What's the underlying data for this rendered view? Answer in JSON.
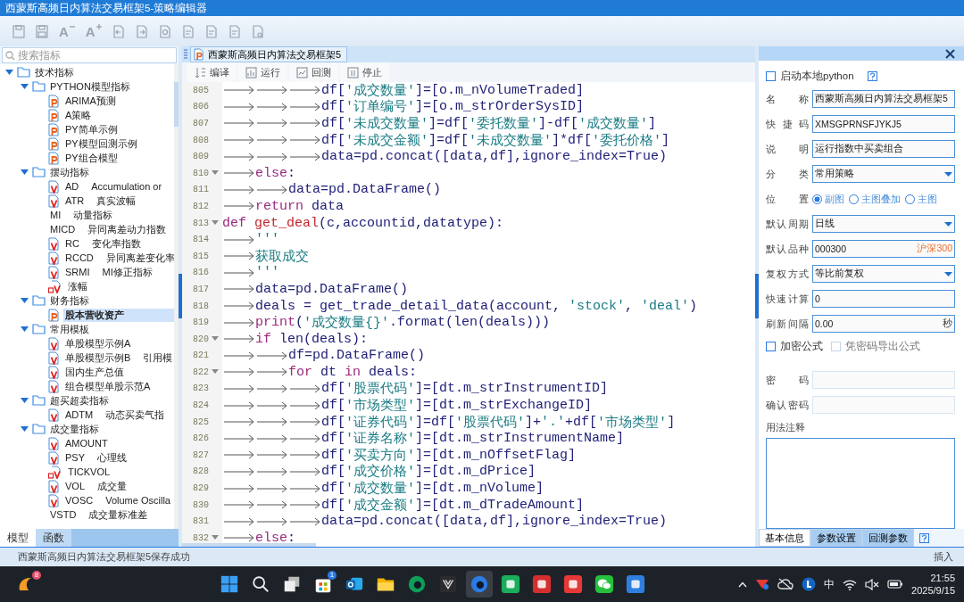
{
  "window": {
    "title": "西蒙斯高频日内算法交易框架5-策略编辑器"
  },
  "toolbar": [
    {
      "kind": "save"
    },
    {
      "kind": "save-all"
    },
    {
      "kind": "font-smaller",
      "label": "A"
    },
    {
      "kind": "font-larger",
      "label": "A"
    },
    {
      "kind": "import"
    },
    {
      "kind": "export"
    },
    {
      "kind": "find"
    },
    {
      "kind": "doc"
    },
    {
      "kind": "doc-edit"
    },
    {
      "kind": "doc"
    },
    {
      "kind": "doc-settings"
    }
  ],
  "sidebar": {
    "search": {
      "placeholder": "搜索指标"
    },
    "tree": [
      {
        "label": "技术指标",
        "kind": "folder",
        "expanded": true,
        "selected": false,
        "children": [
          {
            "label": "PYTHON模型指标",
            "kind": "folder",
            "expanded": true,
            "selected": false,
            "children": [
              {
                "label": "ARIMA预测",
                "kind": "py",
                "selected": false
              },
              {
                "label": "A策略",
                "kind": "py",
                "selected": false
              },
              {
                "label": "PY简单示例",
                "kind": "py",
                "selected": false
              },
              {
                "label": "PY模型回测示例",
                "kind": "py",
                "selected": false
              },
              {
                "label": "PY组合模型",
                "kind": "py",
                "selected": false
              }
            ]
          },
          {
            "label": "摆动指标",
            "kind": "folder",
            "expanded": true,
            "selected": false,
            "children": [
              {
                "label": "AD",
                "desc": "Accumulation or",
                "kind": "v",
                "selected": false
              },
              {
                "label": "ATR",
                "desc": "真实波幅",
                "kind": "v",
                "selected": false
              },
              {
                "label": "MI",
                "desc": "动量指标",
                "kind": "plain",
                "selected": false
              },
              {
                "label": "MICD",
                "desc": "异同离差动力指数",
                "kind": "plain",
                "selected": false
              },
              {
                "label": "RC",
                "desc": "变化率指数",
                "kind": "v",
                "selected": false
              },
              {
                "label": "RCCD",
                "desc": "异同离差变化率",
                "kind": "v",
                "selected": false
              },
              {
                "label": "SRMI",
                "desc": "MI修正指标",
                "kind": "v",
                "selected": false
              },
              {
                "label": "涨幅",
                "kind": "av",
                "selected": false
              }
            ]
          },
          {
            "label": "财务指标",
            "kind": "folder",
            "expanded": true,
            "selected": false,
            "children": [
              {
                "label": "股本营收资产",
                "kind": "py",
                "selected": true
              }
            ]
          },
          {
            "label": "常用模板",
            "kind": "folder",
            "expanded": true,
            "selected": false,
            "children": [
              {
                "label": "单股模型示例A",
                "kind": "v",
                "selected": false
              },
              {
                "label": "单股模型示例B",
                "desc": "引用模",
                "kind": "v",
                "selected": false
              },
              {
                "label": "国内生产总值",
                "kind": "v",
                "selected": false
              },
              {
                "label": "组合模型单股示范A",
                "kind": "v",
                "selected": false
              }
            ]
          },
          {
            "label": "超买超卖指标",
            "kind": "folder",
            "expanded": true,
            "selected": false,
            "children": [
              {
                "label": "ADTM",
                "desc": "动态买卖气指",
                "kind": "v",
                "selected": false
              }
            ]
          },
          {
            "label": "成交量指标",
            "kind": "folder",
            "expanded": true,
            "selected": false,
            "children": [
              {
                "label": "AMOUNT",
                "kind": "v",
                "selected": false
              },
              {
                "label": "PSY",
                "desc": "心理线",
                "kind": "v",
                "selected": false
              },
              {
                "label": "TICKVOL",
                "kind": "av",
                "selected": false
              },
              {
                "label": "VOL",
                "desc": "成交量",
                "kind": "v",
                "selected": false
              },
              {
                "label": "VOSC",
                "desc": "Volume Oscilla",
                "kind": "v",
                "selected": false
              },
              {
                "label": "VSTD",
                "desc": "成交量标准差",
                "kind": "plain",
                "selected": false
              }
            ]
          }
        ]
      }
    ],
    "tabs": [
      {
        "label": "模型",
        "selected": true
      },
      {
        "label": "函数",
        "selected": false
      }
    ]
  },
  "editor": {
    "tab": {
      "label": "西蒙斯高频日内算法交易框架5",
      "selected": true
    },
    "actions": [
      {
        "label": "编译",
        "kind": "compile"
      },
      {
        "label": "运行",
        "kind": "run"
      },
      {
        "label": "回测",
        "kind": "backtest"
      },
      {
        "label": "停止",
        "kind": "stop"
      }
    ],
    "lines": [
      {
        "no": "805",
        "fold": false,
        "tokens": [
          {
            "kind": "tab"
          },
          {
            "kind": "tab"
          },
          {
            "kind": "tab"
          },
          {
            "kind": "plain",
            "text": "df["
          },
          {
            "kind": "string",
            "text": "'成交数量'"
          },
          {
            "kind": "plain",
            "text": "]=[o.m_nVolumeTraded]"
          }
        ]
      },
      {
        "no": "806",
        "fold": false,
        "tokens": [
          {
            "kind": "tab"
          },
          {
            "kind": "tab"
          },
          {
            "kind": "tab"
          },
          {
            "kind": "plain",
            "text": "df["
          },
          {
            "kind": "string",
            "text": "'订单编号'"
          },
          {
            "kind": "plain",
            "text": "]=[o.m_strOrderSysID]"
          }
        ]
      },
      {
        "no": "807",
        "fold": false,
        "tokens": [
          {
            "kind": "tab"
          },
          {
            "kind": "tab"
          },
          {
            "kind": "tab"
          },
          {
            "kind": "plain",
            "text": "df["
          },
          {
            "kind": "string",
            "text": "'未成交数量'"
          },
          {
            "kind": "plain",
            "text": "]=df["
          },
          {
            "kind": "string",
            "text": "'委托数量'"
          },
          {
            "kind": "plain",
            "text": "]-df["
          },
          {
            "kind": "string",
            "text": "'成交数量'"
          },
          {
            "kind": "plain",
            "text": "]"
          }
        ]
      },
      {
        "no": "808",
        "fold": false,
        "tokens": [
          {
            "kind": "tab"
          },
          {
            "kind": "tab"
          },
          {
            "kind": "tab"
          },
          {
            "kind": "plain",
            "text": "df["
          },
          {
            "kind": "string",
            "text": "'未成交金额'"
          },
          {
            "kind": "plain",
            "text": "]=df["
          },
          {
            "kind": "string",
            "text": "'未成交数量'"
          },
          {
            "kind": "plain",
            "text": "]*df["
          },
          {
            "kind": "string",
            "text": "'委托价格'"
          },
          {
            "kind": "plain",
            "text": "]"
          }
        ]
      },
      {
        "no": "809",
        "fold": false,
        "tokens": [
          {
            "kind": "tab"
          },
          {
            "kind": "tab"
          },
          {
            "kind": "tab"
          },
          {
            "kind": "plain",
            "text": "data=pd.concat([data,df],ignore_index=True)"
          }
        ]
      },
      {
        "no": "810",
        "fold": true,
        "tokens": [
          {
            "kind": "tab"
          },
          {
            "kind": "keyword",
            "text": "else"
          },
          {
            "kind": "plain",
            "text": ":"
          }
        ]
      },
      {
        "no": "811",
        "fold": false,
        "tokens": [
          {
            "kind": "tab"
          },
          {
            "kind": "tab"
          },
          {
            "kind": "plain",
            "text": "data=pd.DataFrame()"
          }
        ]
      },
      {
        "no": "812",
        "fold": false,
        "tokens": [
          {
            "kind": "tab"
          },
          {
            "kind": "keyword",
            "text": "return"
          },
          {
            "kind": "plain",
            "text": " data"
          }
        ]
      },
      {
        "no": "813",
        "fold": true,
        "tokens": [
          {
            "kind": "keyword",
            "text": "def"
          },
          {
            "kind": "function",
            "text": " get_deal"
          },
          {
            "kind": "plain",
            "text": "(c,accountid,datatype):"
          }
        ]
      },
      {
        "no": "814",
        "fold": false,
        "tokens": [
          {
            "kind": "tab"
          },
          {
            "kind": "string",
            "text": "'''"
          }
        ]
      },
      {
        "no": "815",
        "fold": false,
        "tokens": [
          {
            "kind": "tab"
          },
          {
            "kind": "string",
            "text": "获取成交"
          }
        ]
      },
      {
        "no": "816",
        "fold": false,
        "tokens": [
          {
            "kind": "tab"
          },
          {
            "kind": "string",
            "text": "'''"
          }
        ]
      },
      {
        "no": "817",
        "fold": false,
        "tokens": [
          {
            "kind": "tab"
          },
          {
            "kind": "plain",
            "text": "data=pd.DataFrame()"
          }
        ]
      },
      {
        "no": "818",
        "fold": false,
        "tokens": [
          {
            "kind": "tab"
          },
          {
            "kind": "plain",
            "text": "deals = get_trade_detail_data(account, "
          },
          {
            "kind": "string",
            "text": "'stock'"
          },
          {
            "kind": "plain",
            "text": ", "
          },
          {
            "kind": "string",
            "text": "'deal'"
          },
          {
            "kind": "plain",
            "text": ")"
          }
        ]
      },
      {
        "no": "819",
        "fold": false,
        "tokens": [
          {
            "kind": "tab"
          },
          {
            "kind": "keyword",
            "text": "print"
          },
          {
            "kind": "plain",
            "text": "("
          },
          {
            "kind": "string",
            "text": "'成交数量{}'"
          },
          {
            "kind": "plain",
            "text": ".format(len(deals)))"
          }
        ]
      },
      {
        "no": "820",
        "fold": true,
        "tokens": [
          {
            "kind": "tab"
          },
          {
            "kind": "keyword",
            "text": "if"
          },
          {
            "kind": "plain",
            "text": " len(deals):"
          }
        ]
      },
      {
        "no": "821",
        "fold": false,
        "tokens": [
          {
            "kind": "tab"
          },
          {
            "kind": "tab"
          },
          {
            "kind": "plain",
            "text": "df=pd.DataFrame()"
          }
        ]
      },
      {
        "no": "822",
        "fold": true,
        "tokens": [
          {
            "kind": "tab"
          },
          {
            "kind": "tab"
          },
          {
            "kind": "keyword",
            "text": "for"
          },
          {
            "kind": "plain",
            "text": " dt "
          },
          {
            "kind": "keyword",
            "text": "in"
          },
          {
            "kind": "plain",
            "text": " deals:"
          }
        ]
      },
      {
        "no": "823",
        "fold": false,
        "tokens": [
          {
            "kind": "tab"
          },
          {
            "kind": "tab"
          },
          {
            "kind": "tab"
          },
          {
            "kind": "plain",
            "text": "df["
          },
          {
            "kind": "string",
            "text": "'股票代码'"
          },
          {
            "kind": "plain",
            "text": "]=[dt.m_strInstrumentID]"
          }
        ]
      },
      {
        "no": "824",
        "fold": false,
        "tokens": [
          {
            "kind": "tab"
          },
          {
            "kind": "tab"
          },
          {
            "kind": "tab"
          },
          {
            "kind": "plain",
            "text": "df["
          },
          {
            "kind": "string",
            "text": "'市场类型'"
          },
          {
            "kind": "plain",
            "text": "]=[dt.m_strExchangeID]"
          }
        ]
      },
      {
        "no": "825",
        "fold": false,
        "tokens": [
          {
            "kind": "tab"
          },
          {
            "kind": "tab"
          },
          {
            "kind": "tab"
          },
          {
            "kind": "plain",
            "text": "df["
          },
          {
            "kind": "string",
            "text": "'证券代码'"
          },
          {
            "kind": "plain",
            "text": "]=df["
          },
          {
            "kind": "string",
            "text": "'股票代码'"
          },
          {
            "kind": "plain",
            "text": "]+"
          },
          {
            "kind": "string",
            "text": "'.'"
          },
          {
            "kind": "plain",
            "text": "+df["
          },
          {
            "kind": "string",
            "text": "'市场类型'"
          },
          {
            "kind": "plain",
            "text": "]"
          }
        ]
      },
      {
        "no": "826",
        "fold": false,
        "tokens": [
          {
            "kind": "tab"
          },
          {
            "kind": "tab"
          },
          {
            "kind": "tab"
          },
          {
            "kind": "plain",
            "text": "df["
          },
          {
            "kind": "string",
            "text": "'证券名称'"
          },
          {
            "kind": "plain",
            "text": "]=[dt.m_strInstrumentName]"
          }
        ]
      },
      {
        "no": "827",
        "fold": false,
        "tokens": [
          {
            "kind": "tab"
          },
          {
            "kind": "tab"
          },
          {
            "kind": "tab"
          },
          {
            "kind": "plain",
            "text": "df["
          },
          {
            "kind": "string",
            "text": "'买卖方向'"
          },
          {
            "kind": "plain",
            "text": "]=[dt.m_nOffsetFlag]"
          }
        ]
      },
      {
        "no": "828",
        "fold": false,
        "tokens": [
          {
            "kind": "tab"
          },
          {
            "kind": "tab"
          },
          {
            "kind": "tab"
          },
          {
            "kind": "plain",
            "text": "df["
          },
          {
            "kind": "string",
            "text": "'成交价格'"
          },
          {
            "kind": "plain",
            "text": "]=[dt.m_dPrice]"
          }
        ]
      },
      {
        "no": "829",
        "fold": false,
        "tokens": [
          {
            "kind": "tab"
          },
          {
            "kind": "tab"
          },
          {
            "kind": "tab"
          },
          {
            "kind": "plain",
            "text": "df["
          },
          {
            "kind": "string",
            "text": "'成交数量'"
          },
          {
            "kind": "plain",
            "text": "]=[dt.m_nVolume]"
          }
        ]
      },
      {
        "no": "830",
        "fold": false,
        "tokens": [
          {
            "kind": "tab"
          },
          {
            "kind": "tab"
          },
          {
            "kind": "tab"
          },
          {
            "kind": "plain",
            "text": "df["
          },
          {
            "kind": "string",
            "text": "'成交金额'"
          },
          {
            "kind": "plain",
            "text": "]=[dt.m_dTradeAmount]"
          }
        ]
      },
      {
        "no": "831",
        "fold": false,
        "tokens": [
          {
            "kind": "tab"
          },
          {
            "kind": "tab"
          },
          {
            "kind": "tab"
          },
          {
            "kind": "plain",
            "text": "data=pd.concat([data,df],ignore_index=True)"
          }
        ]
      },
      {
        "no": "832",
        "fold": true,
        "tokens": [
          {
            "kind": "tab"
          },
          {
            "kind": "keyword",
            "text": "else"
          },
          {
            "kind": "plain",
            "text": ":"
          }
        ]
      }
    ]
  },
  "properties": {
    "local_python": {
      "label": "启动本地python",
      "checked": false
    },
    "fields": [
      {
        "kind": "text",
        "label": "名称",
        "value": "西蒙斯高频日内算法交易框架5"
      },
      {
        "kind": "text",
        "label": "快捷码",
        "value": "XMSGPRNSFJYKJ5"
      },
      {
        "kind": "text",
        "label": "说明",
        "value": "运行指数中买卖组合"
      },
      {
        "kind": "select",
        "label": "分类",
        "value": "常用策略"
      },
      {
        "kind": "radio",
        "label": "位置",
        "options": [
          {
            "label": "副图",
            "selected": true
          },
          {
            "label": "主图叠加",
            "selected": false
          },
          {
            "label": "主图",
            "selected": false
          }
        ]
      },
      {
        "kind": "select",
        "label": "默认周期",
        "value": "日线"
      },
      {
        "kind": "text",
        "label": "默认品种",
        "value": "000300",
        "suffix": "沪深300",
        "suffix_highlighted": true
      },
      {
        "kind": "select",
        "label": "复权方式",
        "value": "等比前复权"
      },
      {
        "kind": "text",
        "label": "快速计算",
        "value": "0"
      },
      {
        "kind": "text",
        "label": "刷新间隔",
        "value": "0.00",
        "suffix": "秒",
        "suffix_highlighted": false
      }
    ],
    "checks": [
      {
        "label": "加密公式",
        "checked": false,
        "disabled": false
      },
      {
        "label": "凭密码导出公式",
        "checked": false,
        "disabled": true
      }
    ],
    "password_fields": [
      {
        "label": "密码",
        "disabled": true
      },
      {
        "label": "确认密码",
        "disabled": true
      }
    ],
    "notes": {
      "label": "用法注释"
    },
    "tabs": [
      {
        "label": "基本信息",
        "selected": true
      },
      {
        "label": "参数设置",
        "selected": false
      },
      {
        "label": "回测参数",
        "selected": false
      }
    ]
  },
  "status_bar": {
    "message": "西蒙斯高频日内算法交易框架5保存成功",
    "mode": "插入"
  },
  "taskbar": {
    "widget_badge": "8",
    "store_badge": "1",
    "ime": "中",
    "time": "21:55",
    "date": "2025/9/15"
  }
}
